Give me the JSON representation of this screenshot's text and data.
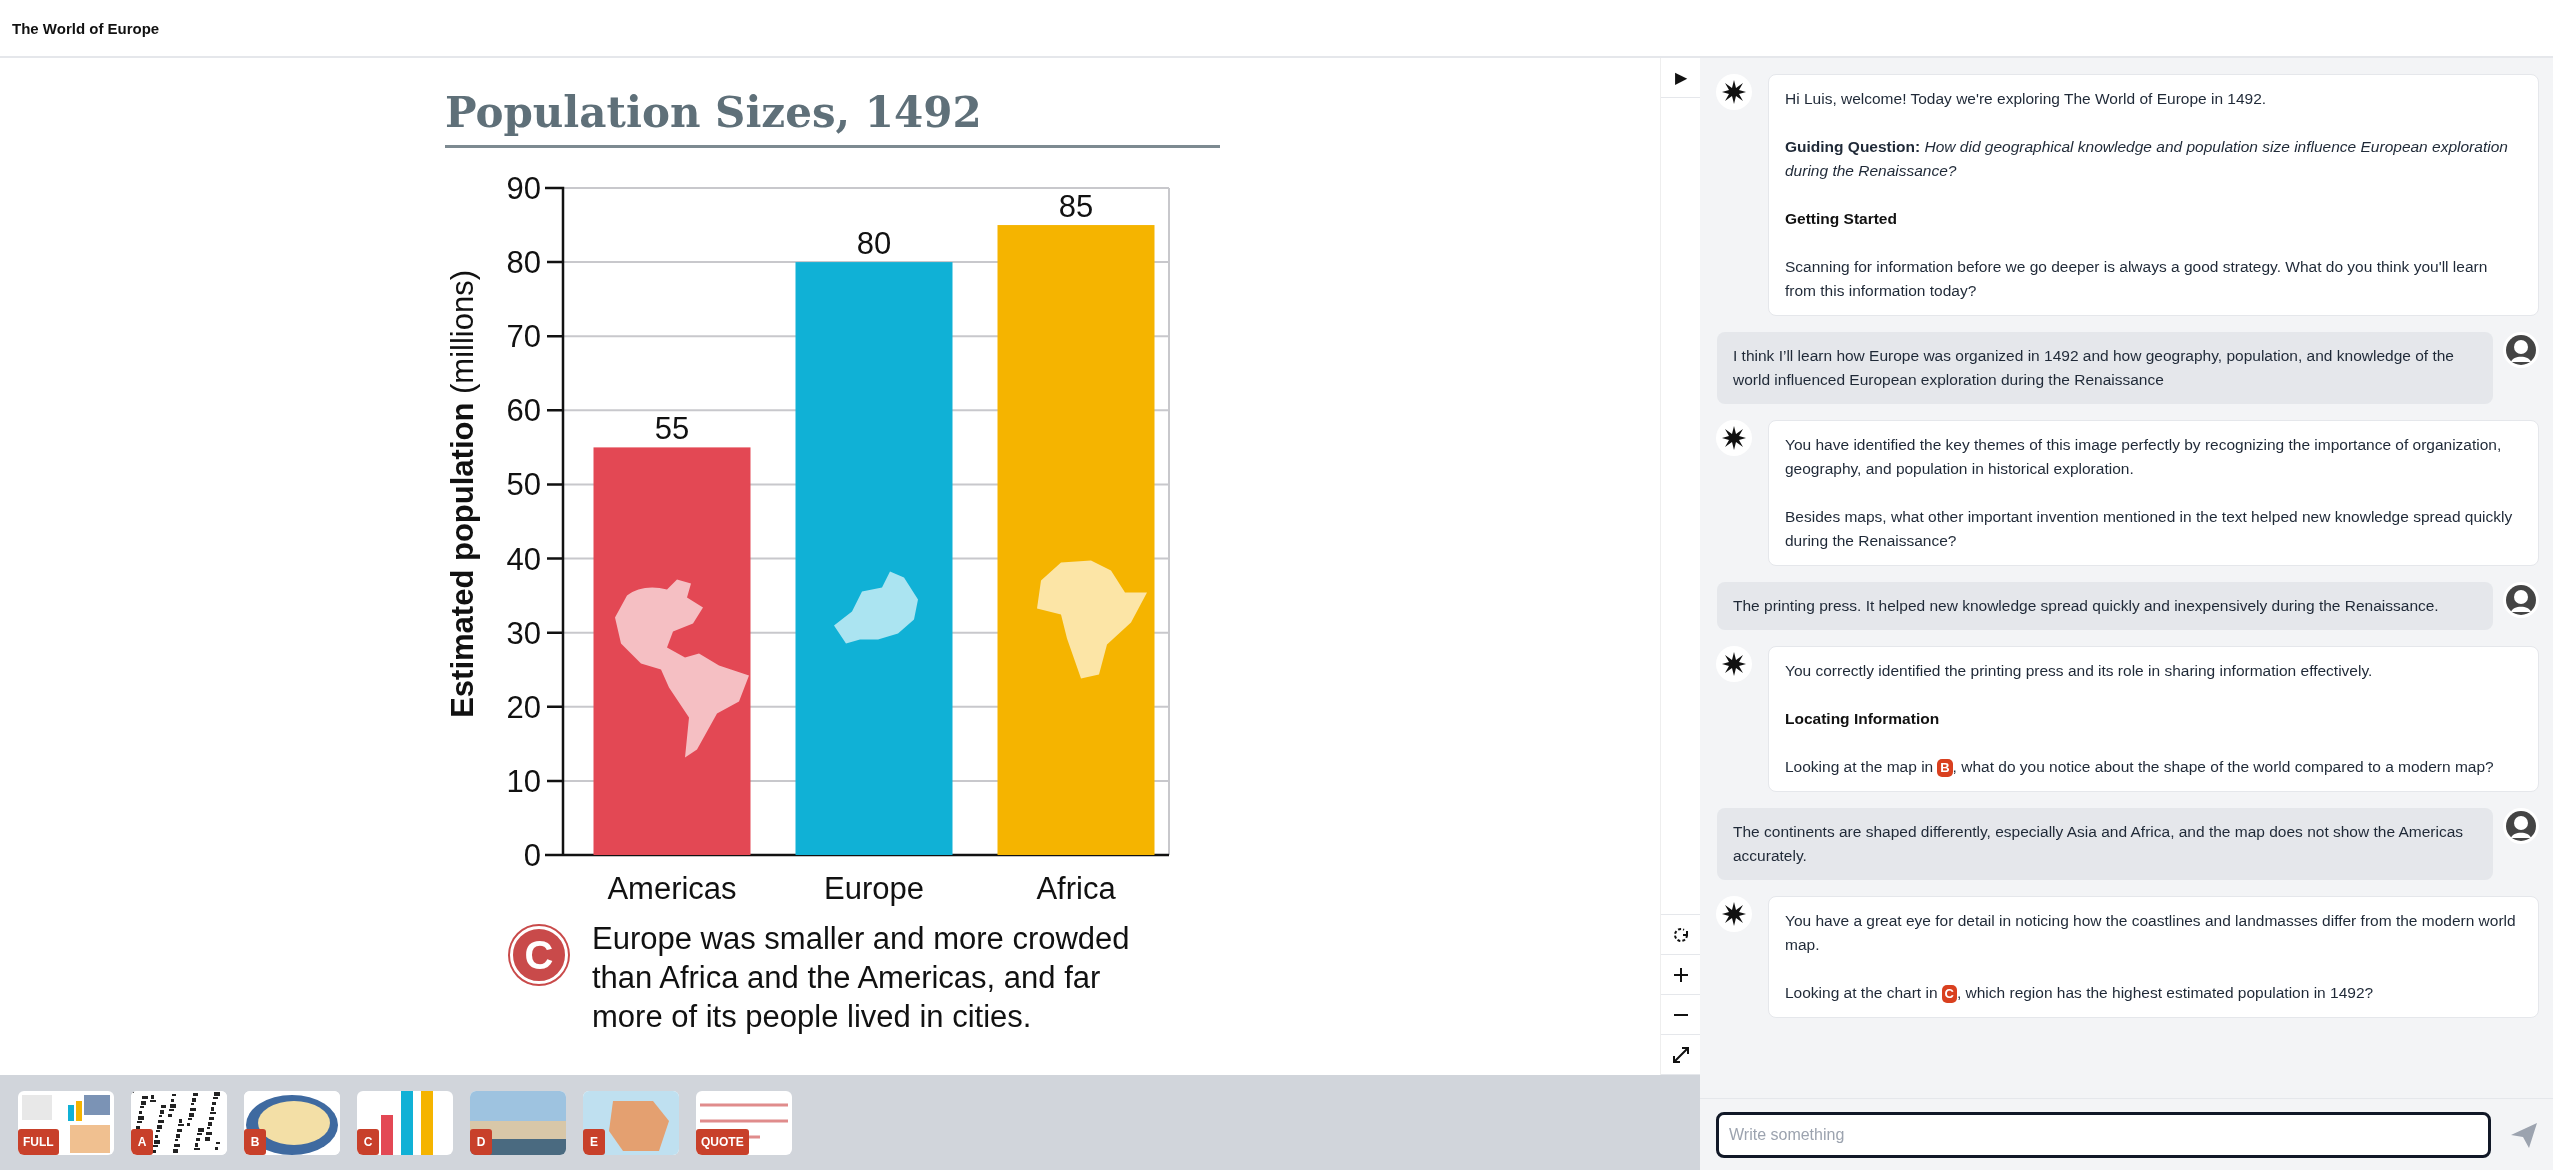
{
  "header": {
    "title": "The World of Europe"
  },
  "figure": {
    "title": "Population Sizes, 1492",
    "chart_data": {
      "type": "bar",
      "ylabel": "**Estimated population** (millions)",
      "categories": [
        "Americas",
        "Europe",
        "Africa"
      ],
      "values": [
        55,
        80,
        85
      ],
      "ylim": [
        0,
        90
      ],
      "yticks": [
        0,
        10,
        20,
        30,
        40,
        50,
        60,
        70,
        80,
        90
      ],
      "grid": true,
      "data_labels": true
    },
    "bars": [
      {
        "color": "#e34854"
      },
      {
        "color": "#10b1d6"
      },
      {
        "color": "#f5b400"
      }
    ],
    "badge": "C",
    "caption": "Europe was smaller and more crowded than Africa and the Americas, and far more of its people lived in cities."
  },
  "thumbnails": [
    {
      "label": "FULL",
      "kind": "collage"
    },
    {
      "label": "A",
      "kind": "texture"
    },
    {
      "label": "B",
      "kind": "oldmap"
    },
    {
      "label": "C",
      "kind": "chart"
    },
    {
      "label": "D",
      "kind": "photo"
    },
    {
      "label": "E",
      "kind": "map"
    },
    {
      "label": "QUOTE",
      "kind": "quote"
    }
  ],
  "tools": {
    "top": "▶",
    "bottom": [
      {
        "kind": "reload"
      },
      {
        "kind": "zoom_in"
      },
      {
        "kind": "zoom_out"
      },
      {
        "kind": "expand"
      }
    ]
  },
  "chat": {
    "messages": [
      {
        "kind": "bot",
        "paragraphs": [
          {
            "kind": "text",
            "text": "Hi Luis, welcome! Today we're exploring The World of Europe in 1492."
          },
          {
            "kind": "text",
            "text": "**Guiding Question:** *How did geographical knowledge and population size influence European exploration during the Renaissance?*"
          },
          {
            "kind": "heading",
            "text": "Getting Started"
          },
          {
            "kind": "text",
            "text": "Scanning for information before we go deeper is always a good strategy. What do you think you'll learn from this information today?"
          }
        ]
      },
      {
        "kind": "user",
        "paragraphs": [
          {
            "kind": "text",
            "text": "I think I’ll learn how Europe was organized in 1492 and how geography, population, and knowledge of the world influenced European exploration during the Renaissance"
          }
        ]
      },
      {
        "kind": "bot",
        "paragraphs": [
          {
            "kind": "text",
            "text": "You have identified the key themes of this image perfectly by recognizing the importance of organization, geography, and population in historical exploration."
          },
          {
            "kind": "text",
            "text": "Besides maps, what other important invention mentioned in the text helped new knowledge spread quickly during the Renaissance?"
          }
        ]
      },
      {
        "kind": "user",
        "paragraphs": [
          {
            "kind": "text",
            "text": "The printing press. It helped new knowledge spread quickly and inexpensively during the Renaissance."
          }
        ]
      },
      {
        "kind": "bot",
        "paragraphs": [
          {
            "kind": "text",
            "text": "You correctly identified the printing press and its role in sharing information effectively."
          },
          {
            "kind": "heading",
            "text": "Locating Information"
          },
          {
            "kind": "ref",
            "before": "Looking at the map in",
            "badge": "B",
            "after": ", what do you notice about the shape of the world compared to a modern map?"
          }
        ]
      },
      {
        "kind": "user",
        "paragraphs": [
          {
            "kind": "text",
            "text": "The continents are shaped differently, especially Asia and Africa, and the map does not show the Americas accurately."
          }
        ]
      },
      {
        "kind": "bot",
        "paragraphs": [
          {
            "kind": "text",
            "text": "You have a great eye for detail in noticing how the coastlines and landmasses differ from the modern world map."
          },
          {
            "kind": "ref",
            "before": "Looking at the chart in",
            "badge": "C",
            "after": ", which region has the highest estimated population in 1492?"
          }
        ]
      }
    ],
    "input": {
      "placeholder": "Write something"
    }
  }
}
